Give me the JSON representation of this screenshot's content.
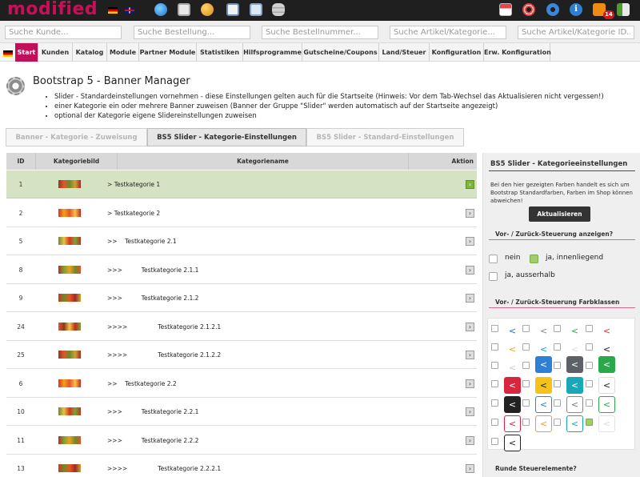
{
  "app": {
    "logo": "modified",
    "logo_color": "#c90f5a",
    "language_flags": [
      "german-flag",
      "english-flag"
    ],
    "top_left_icons": [
      "globe-icon",
      "cash-register-icon",
      "users-icon",
      "calculator-icon",
      "copy-icon",
      "database-icon"
    ],
    "top_right_icons": [
      "shop-icon",
      "help-lifebuoy-icon",
      "refresh-icon",
      "info-icon",
      "rss-icon",
      "logout-icon"
    ],
    "rss_badge": "14"
  },
  "search": {
    "customer_placeholder": "Suche Kunde...",
    "order_placeholder": "Suche Bestellung...",
    "ordernumber_placeholder": "Suche Bestellnummer...",
    "article_placeholder": "Suche Artikel/Kategorie...",
    "article_id_placeholder": "Suche Artikel/Kategorie ID..."
  },
  "nav": {
    "items": [
      "Start",
      "Kunden",
      "Katalog",
      "Module",
      "Partner Module",
      "Statistiken",
      "Hilfsprogramme",
      "Gutscheine/Coupons",
      "Land/Steuer",
      "Konfiguration",
      "Erw. Konfiguration"
    ],
    "active_index": 0,
    "active_color": "#c20f5a"
  },
  "page": {
    "icon": "gears-icon",
    "title": "Bootstrap 5 - Banner Manager",
    "bullets": [
      "Slider - Standardeinstellungen vornehmen - diese Einstellungen gelten auch für die Startseite (Hinweis: Vor dem Tab-Wechsel das Aktualisieren nicht vergessen!)",
      "einer Kategorie ein oder mehrere Banner zuweisen (Banner der Gruppe \"Slider\" werden automatisch auf der Startseite angezeigt)",
      "optional der Kategorie eigene Slidereinstellungen zuweisen"
    ]
  },
  "tabs": [
    {
      "label": "Banner - Kategorie - Zuweisung",
      "active": false
    },
    {
      "label": "BS5 Slider - Kategorie-Einstellungen",
      "active": true
    },
    {
      "label": "BS5 Slider - Standard-Einstellungen",
      "active": false
    }
  ],
  "table": {
    "headers": {
      "id": "ID",
      "image": "Kategoriebild",
      "name": "Kategoriename",
      "action": "Aktion"
    },
    "rows": [
      {
        "id": "1",
        "prefix": ">",
        "name": "Testkategorie 1",
        "highlight": true
      },
      {
        "id": "2",
        "prefix": ">",
        "name": "Testkategorie 2",
        "highlight": false
      },
      {
        "id": "5",
        "prefix": ">>",
        "name": "Testkategorie 2.1",
        "highlight": false
      },
      {
        "id": "8",
        "prefix": ">>>",
        "name": "Testkategorie 2.1.1",
        "highlight": false
      },
      {
        "id": "9",
        "prefix": ">>>",
        "name": "Testkategorie 2.1.2",
        "highlight": false
      },
      {
        "id": "24",
        "prefix": ">>>>",
        "name": "Testkategorie 2.1.2.1",
        "highlight": false
      },
      {
        "id": "25",
        "prefix": ">>>>",
        "name": "Testkategorie 2.1.2.2",
        "highlight": false
      },
      {
        "id": "6",
        "prefix": ">>",
        "name": "Testkategorie 2.2",
        "highlight": false
      },
      {
        "id": "10",
        "prefix": ">>>",
        "name": "Testkategorie 2.2.1",
        "highlight": false
      },
      {
        "id": "11",
        "prefix": ">>>",
        "name": "Testkategorie 2.2.2",
        "highlight": false
      },
      {
        "id": "13",
        "prefix": ">>>>",
        "name": "Testkategorie 2.2.2.1",
        "highlight": false
      }
    ],
    "action_icon": "arrow-right-icon"
  },
  "panel": {
    "title": "BS5 Slider - Kategorieeinstellungen",
    "note": "Bei den hier gezeigten Farben handelt es sich um Bootstrap Standardfarben, Farben im Shop können abweichen!",
    "update_button": "Aktualisieren",
    "controls_heading": "Vor- / Zurück-Steuerung anzeigen?",
    "options": [
      {
        "label": "nein",
        "checked": false
      },
      {
        "label": "ja, innenliegend",
        "checked": true
      },
      {
        "label": "ja, ausserhalb",
        "checked": false
      }
    ],
    "colors_heading": "Vor- / Zurück-Steuerung Farbklassen",
    "arrow_glyph": "<",
    "rounded_heading": "Runde Steuerelemente?"
  }
}
